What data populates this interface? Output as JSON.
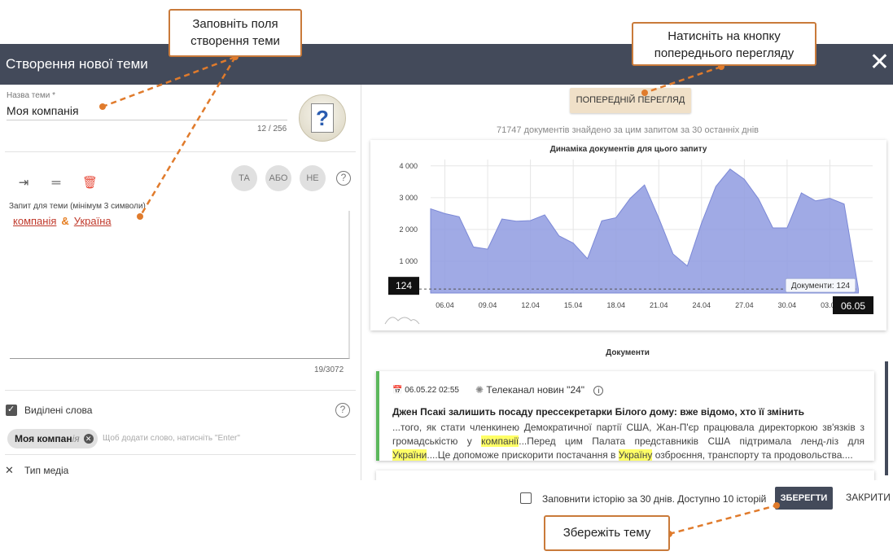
{
  "header": {
    "title": "Створення нової теми",
    "close_icon": "close-icon"
  },
  "topic": {
    "name_label": "Назва теми *",
    "name_value": "Моя компанія",
    "name_counter": "12 / 256"
  },
  "operators": {
    "and": "ТА",
    "or": "АБО",
    "not": "НЕ",
    "help": "?"
  },
  "query": {
    "label": "Запит для теми (мінімум 3 символи)",
    "word1": "компанія",
    "operator": "&",
    "word2": "Україна",
    "counter": "19/3072"
  },
  "highlight": {
    "label": "Виділені слова",
    "help": "?",
    "chip_main": "Моя компан",
    "chip_rest": "ія",
    "chip_remove": "✕",
    "hint": "Щоб додати слово, натисніть \"Enter\""
  },
  "media": {
    "label": "Тип медіа"
  },
  "preview": {
    "button": "ПОПЕРЕДНІЙ ПЕРЕГЛЯД",
    "found_text": "71747 документів знайдено за цим запитом за 30 останніх днів"
  },
  "chart_data": {
    "type": "area",
    "title": "Динаміка документів для цього запиту",
    "x": [
      "05.04",
      "06.04",
      "07.04",
      "08.04",
      "09.04",
      "10.04",
      "11.04",
      "12.04",
      "13.04",
      "14.04",
      "15.04",
      "16.04",
      "17.04",
      "18.04",
      "19.04",
      "20.04",
      "21.04",
      "22.04",
      "23.04",
      "24.04",
      "25.04",
      "26.04",
      "27.04",
      "28.04",
      "29.04",
      "30.04",
      "01.05",
      "02.05",
      "03.05",
      "04.05",
      "05.05",
      "06.05"
    ],
    "values": [
      2650,
      2500,
      2400,
      1450,
      1380,
      2330,
      2260,
      2280,
      2460,
      1800,
      1570,
      1080,
      2270,
      2370,
      2980,
      3400,
      2360,
      1230,
      850,
      2200,
      3350,
      3900,
      3580,
      2960,
      2050,
      2050,
      3150,
      2900,
      2980,
      2800,
      124
    ],
    "x_tick_labels": [
      "06.04",
      "09.04",
      "12.04",
      "15.04",
      "18.04",
      "21.04",
      "24.04",
      "27.04",
      "30.04",
      "03.05"
    ],
    "y_tick_labels": [
      "1 000",
      "2 000",
      "3 000",
      "4 000"
    ],
    "ylim": [
      0,
      4200
    ],
    "current_value_label": "124",
    "current_date_label": "06.05",
    "tooltip": "Документи: 124",
    "color": "#8f9be0",
    "grid": true
  },
  "documents": {
    "title": "Документи",
    "items": [
      {
        "date": "06.05.22 02:55",
        "source": "Телеканал новин \"24\"",
        "headline": "Джен Псакі залишить посаду прессекретарки Білого дому: вже відомо, хто її змінить",
        "body_1": "...того, як стати членкинею Демократичної партії США, Жан-П'єр працювала директоркою зв'язків з громадськістю у ",
        "hl_1": "компанії",
        "body_2": "...Перед цим Палата представників США підтримала ленд-ліз для ",
        "hl_2": "України",
        "body_3": "....Це допоможе прискорити постачання в ",
        "hl_3": "Україну",
        "body_4": " озброєння, транспорту та продовольства...."
      }
    ]
  },
  "footer": {
    "history_text": "Заповнити історію за 30 днів. Доступно 10 історій",
    "save": "ЗБЕРЕГТИ",
    "close": "ЗАКРИТИ"
  },
  "callouts": {
    "fill": "Заповніть поля створення теми",
    "preview": "Натисніть на кнопку попереднього перегляду",
    "save": "Збережіть тему"
  }
}
